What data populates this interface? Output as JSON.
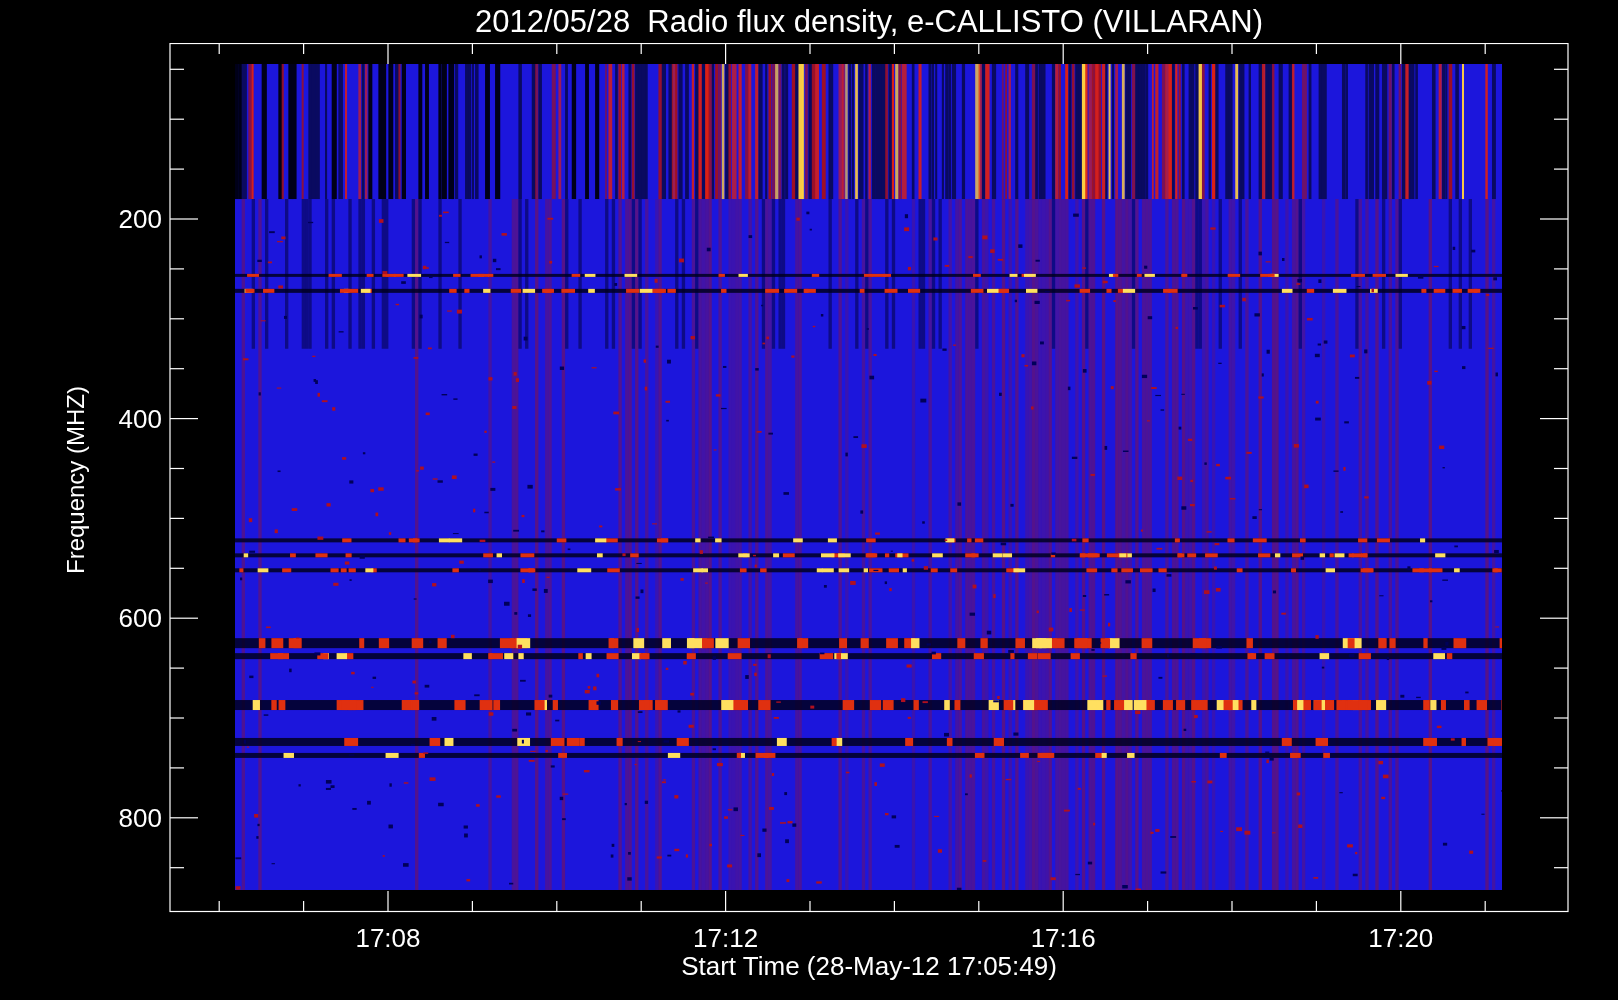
{
  "title": "2012/05/28  Radio flux density, e-CALLISTO (VILLARAN)",
  "plot": {
    "ylabel": "Frequency (MHZ)",
    "xlabel": "Start Time (28-May-12 17:05:49)",
    "yticks": [
      "200",
      "400",
      "600",
      "800"
    ],
    "xticks": [
      "17:08",
      "17:12",
      "17:16",
      "17:20"
    ]
  }
}
